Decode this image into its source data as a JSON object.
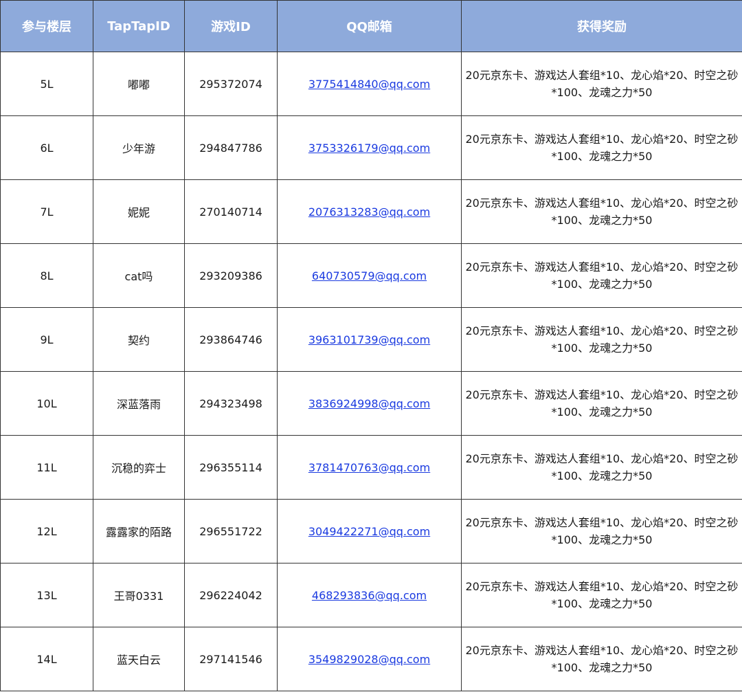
{
  "headers": [
    "参与楼层",
    "TapTapID",
    "游戏ID",
    "QQ邮箱",
    "获得奖励"
  ],
  "rows": [
    {
      "floor": "5L",
      "taptap_id": "嘟嘟",
      "game_id": "295372074",
      "email": "3775414840@qq.com",
      "reward": "20元京东卡、游戏达人套组*10、龙心焰*20、时空之砂*100、龙魂之力*50"
    },
    {
      "floor": "6L",
      "taptap_id": "少年游",
      "game_id": "294847786",
      "email": "3753326179@qq.com",
      "reward": "20元京东卡、游戏达人套组*10、龙心焰*20、时空之砂*100、龙魂之力*50"
    },
    {
      "floor": "7L",
      "taptap_id": "妮妮",
      "game_id": "270140714",
      "email": "2076313283@qq.com",
      "reward": "20元京东卡、游戏达人套组*10、龙心焰*20、时空之砂*100、龙魂之力*50"
    },
    {
      "floor": "8L",
      "taptap_id": "cat吗",
      "game_id": "293209386",
      "email": "640730579@qq.com",
      "reward": "20元京东卡、游戏达人套组*10、龙心焰*20、时空之砂*100、龙魂之力*50"
    },
    {
      "floor": "9L",
      "taptap_id": "契约",
      "game_id": "293864746",
      "email": "3963101739@qq.com",
      "reward": "20元京东卡、游戏达人套组*10、龙心焰*20、时空之砂*100、龙魂之力*50"
    },
    {
      "floor": "10L",
      "taptap_id": "深蓝落雨",
      "game_id": "294323498",
      "email": "3836924998@qq.com",
      "reward": "20元京东卡、游戏达人套组*10、龙心焰*20、时空之砂*100、龙魂之力*50"
    },
    {
      "floor": "11L",
      "taptap_id": "沉稳的弈士",
      "game_id": "296355114",
      "email": "3781470763@qq.com",
      "reward": "20元京东卡、游戏达人套组*10、龙心焰*20、时空之砂*100、龙魂之力*50"
    },
    {
      "floor": "12L",
      "taptap_id": "露露家的陌路",
      "game_id": "296551722",
      "email": "3049422271@qq.com",
      "reward": "20元京东卡、游戏达人套组*10、龙心焰*20、时空之砂*100、龙魂之力*50"
    },
    {
      "floor": "13L",
      "taptap_id": "王哥0331",
      "game_id": "296224042",
      "email": "468293836@qq.com",
      "reward": "20元京东卡、游戏达人套组*10、龙心焰*20、时空之砂*100、龙魂之力*50"
    },
    {
      "floor": "14L",
      "taptap_id": "蓝天白云",
      "game_id": "297141546",
      "email": "3549829028@qq.com",
      "reward": "20元京东卡、游戏达人套组*10、龙心焰*20、时空之砂*100、龙魂之力*50"
    }
  ],
  "colors": {
    "header_bg": "#8eaadb",
    "header_text": "#ffffff",
    "link": "#1a3ae0",
    "border": "#333333"
  }
}
